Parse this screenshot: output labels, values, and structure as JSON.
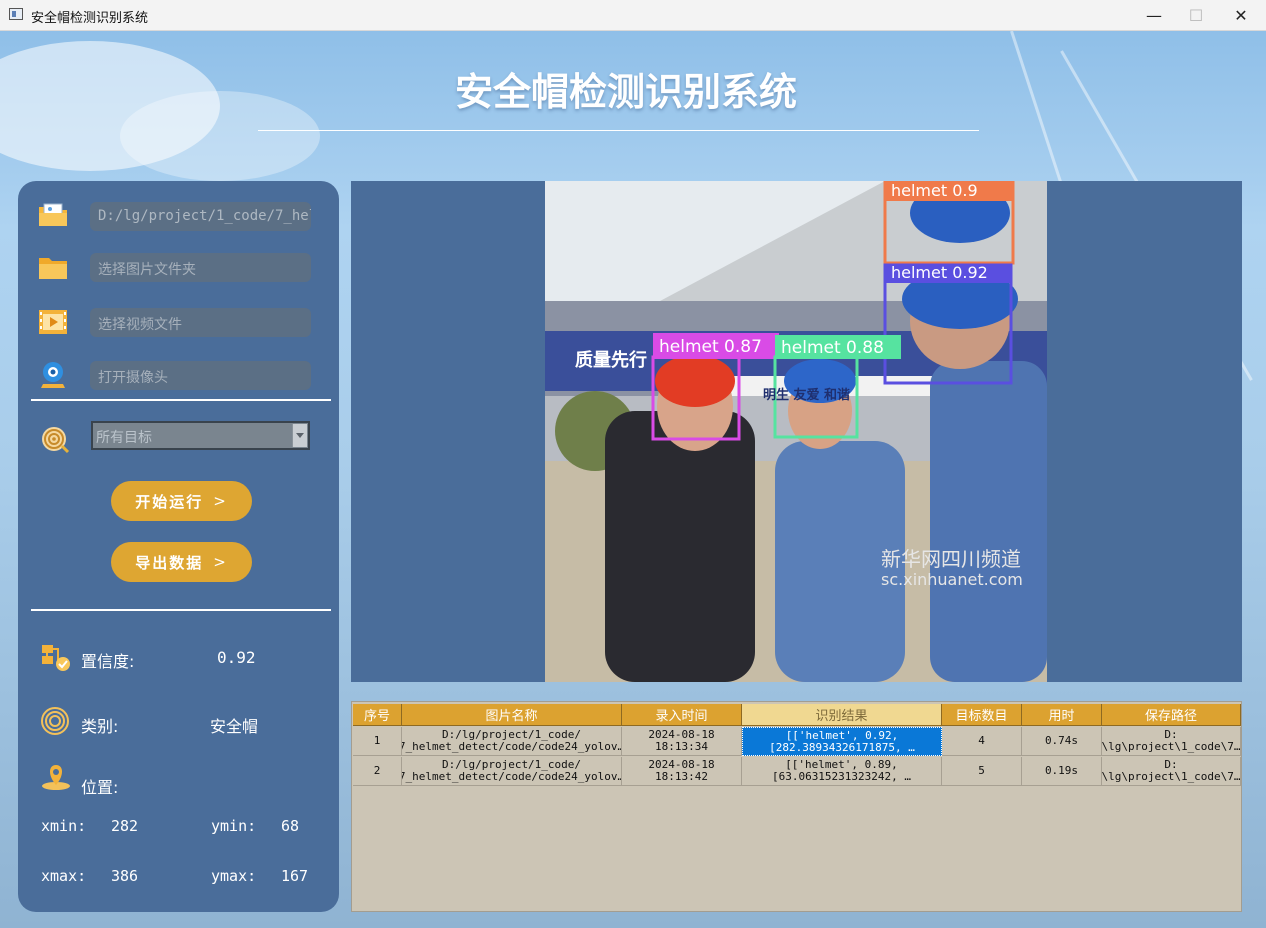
{
  "window": {
    "title": "安全帽检测识别系统",
    "controls": [
      "—",
      "☐",
      "✕"
    ]
  },
  "header": {
    "title": "安全帽检测识别系统"
  },
  "inputs": {
    "image_path": "D:/lg/project/1_code/7_helm",
    "folder_placeholder": "选择图片文件夹",
    "video_placeholder": "选择视频文件",
    "camera_placeholder": "打开摄像头"
  },
  "target_select": {
    "value": "所有目标"
  },
  "buttons": {
    "start": "开始运行",
    "export": "导出数据",
    "chevron": ">"
  },
  "info": {
    "confidence_label": "置信度:",
    "confidence_value": "0.92",
    "class_label": "类别:",
    "class_value": "安全帽",
    "position_label": "位置:",
    "xmin_label": "xmin:",
    "xmin": "282",
    "ymin_label": "ymin:",
    "ymin": "68",
    "xmax_label": "xmax:",
    "xmax": "386",
    "ymax_label": "ymax:",
    "ymax": "167"
  },
  "detections": [
    {
      "label": "helmet 0.9",
      "color": "#f07a4a"
    },
    {
      "label": "helmet 0.92",
      "color": "#5a4fe0"
    },
    {
      "label": "helmet 0.87",
      "color": "#d94be6"
    },
    {
      "label": "helmet 0.88",
      "color": "#56e3a0"
    }
  ],
  "photo_text": {
    "sign_left": "质量先行",
    "sign_mid": "明生 友爱 和谐",
    "watermark_cn": "新华网四川频道",
    "watermark_url": "sc.xinhuanet.com"
  },
  "table": {
    "headers": [
      "序号",
      "图片名称",
      "录入时间",
      "识别结果",
      "目标数目",
      "用时",
      "保存路径"
    ],
    "rows": [
      [
        "1",
        "D:/lg/project/1_code/\n7_helmet_detect/code/code24_yolov…",
        "2024-08-18\n18:13:34",
        "[['helmet', 0.92,\n[282.38934326171875, …",
        "4",
        "0.74s",
        "D:\n\\lg\\project\\1_code\\7…"
      ],
      [
        "2",
        "D:/lg/project/1_code/\n7_helmet_detect/code/code24_yolov…",
        "2024-08-18\n18:13:42",
        "[['helmet', 0.89,\n[63.06315231323242, …",
        "5",
        "0.19s",
        "D:\n\\lg\\project\\1_code\\7…"
      ]
    ]
  }
}
